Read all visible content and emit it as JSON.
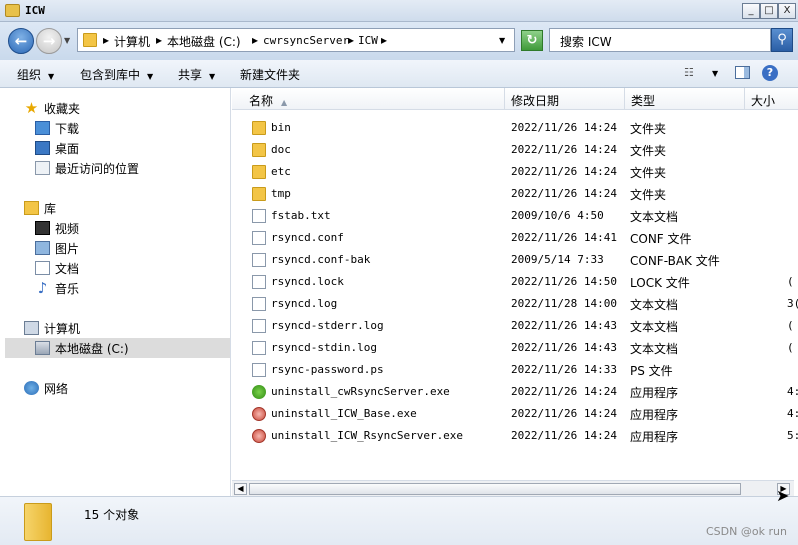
{
  "window": {
    "title": "ICW",
    "min": "_",
    "max": "□",
    "close": "X"
  },
  "address": {
    "crumbs": [
      "计算机",
      "本地磁盘 (C:)",
      "cwrsyncServer",
      "ICW"
    ],
    "separator": "▸",
    "search_placeholder": "搜索 ICW"
  },
  "toolbar": {
    "organize": "组织",
    "include": "包含到库中",
    "share": "共享",
    "new_folder": "新建文件夹",
    "dropdown": "▼"
  },
  "nav": {
    "favorites": {
      "label": "收藏夹",
      "items": [
        "下载",
        "桌面",
        "最近访问的位置"
      ]
    },
    "libraries": {
      "label": "库",
      "items": [
        "视频",
        "图片",
        "文档",
        "音乐"
      ]
    },
    "computer": {
      "label": "计算机",
      "items": [
        "本地磁盘 (C:)"
      ]
    },
    "network": {
      "label": "网络"
    }
  },
  "columns": {
    "name": "名称",
    "date": "修改日期",
    "type": "类型",
    "size": "大小"
  },
  "files": [
    {
      "name": "bin",
      "date": "2022/11/26 14:24",
      "type": "文件夹",
      "size": "",
      "icon": "folder-icon"
    },
    {
      "name": "doc",
      "date": "2022/11/26 14:24",
      "type": "文件夹",
      "size": "",
      "icon": "folder-icon"
    },
    {
      "name": "etc",
      "date": "2022/11/26 14:24",
      "type": "文件夹",
      "size": "",
      "icon": "folder-icon"
    },
    {
      "name": "tmp",
      "date": "2022/11/26 14:24",
      "type": "文件夹",
      "size": "",
      "icon": "folder-icon"
    },
    {
      "name": "fstab.txt",
      "date": "2009/10/6 4:50",
      "type": "文本文档",
      "size": "",
      "icon": "text-file-icon"
    },
    {
      "name": "rsyncd.conf",
      "date": "2022/11/26 14:41",
      "type": "CONF 文件",
      "size": "",
      "icon": "file-icon"
    },
    {
      "name": "rsyncd.conf-bak",
      "date": "2009/5/14 7:33",
      "type": "CONF-BAK 文件",
      "size": "",
      "icon": "file-icon"
    },
    {
      "name": "rsyncd.lock",
      "date": "2022/11/26 14:50",
      "type": "LOCK 文件",
      "size": "(",
      "icon": "file-icon"
    },
    {
      "name": "rsyncd.log",
      "date": "2022/11/28 14:00",
      "type": "文本文档",
      "size": "3(",
      "icon": "text-file-icon"
    },
    {
      "name": "rsyncd-stderr.log",
      "date": "2022/11/26 14:43",
      "type": "文本文档",
      "size": "(",
      "icon": "text-file-icon"
    },
    {
      "name": "rsyncd-stdin.log",
      "date": "2022/11/26 14:43",
      "type": "文本文档",
      "size": "(",
      "icon": "text-file-icon"
    },
    {
      "name": "rsync-password.ps",
      "date": "2022/11/26 14:33",
      "type": "PS 文件",
      "size": "",
      "icon": "file-icon"
    },
    {
      "name": "uninstall_cwRsyncServer.exe",
      "date": "2022/11/26 14:24",
      "type": "应用程序",
      "size": "4:",
      "icon": "frog-app-icon"
    },
    {
      "name": "uninstall_ICW_Base.exe",
      "date": "2022/11/26 14:24",
      "type": "应用程序",
      "size": "4:",
      "icon": "setup-app-icon"
    },
    {
      "name": "uninstall_ICW_RsyncServer.exe",
      "date": "2022/11/26 14:24",
      "type": "应用程序",
      "size": "5:",
      "icon": "setup-app-icon"
    }
  ],
  "status": {
    "count_text": "15 个对象"
  },
  "watermark": "CSDN @ok run"
}
